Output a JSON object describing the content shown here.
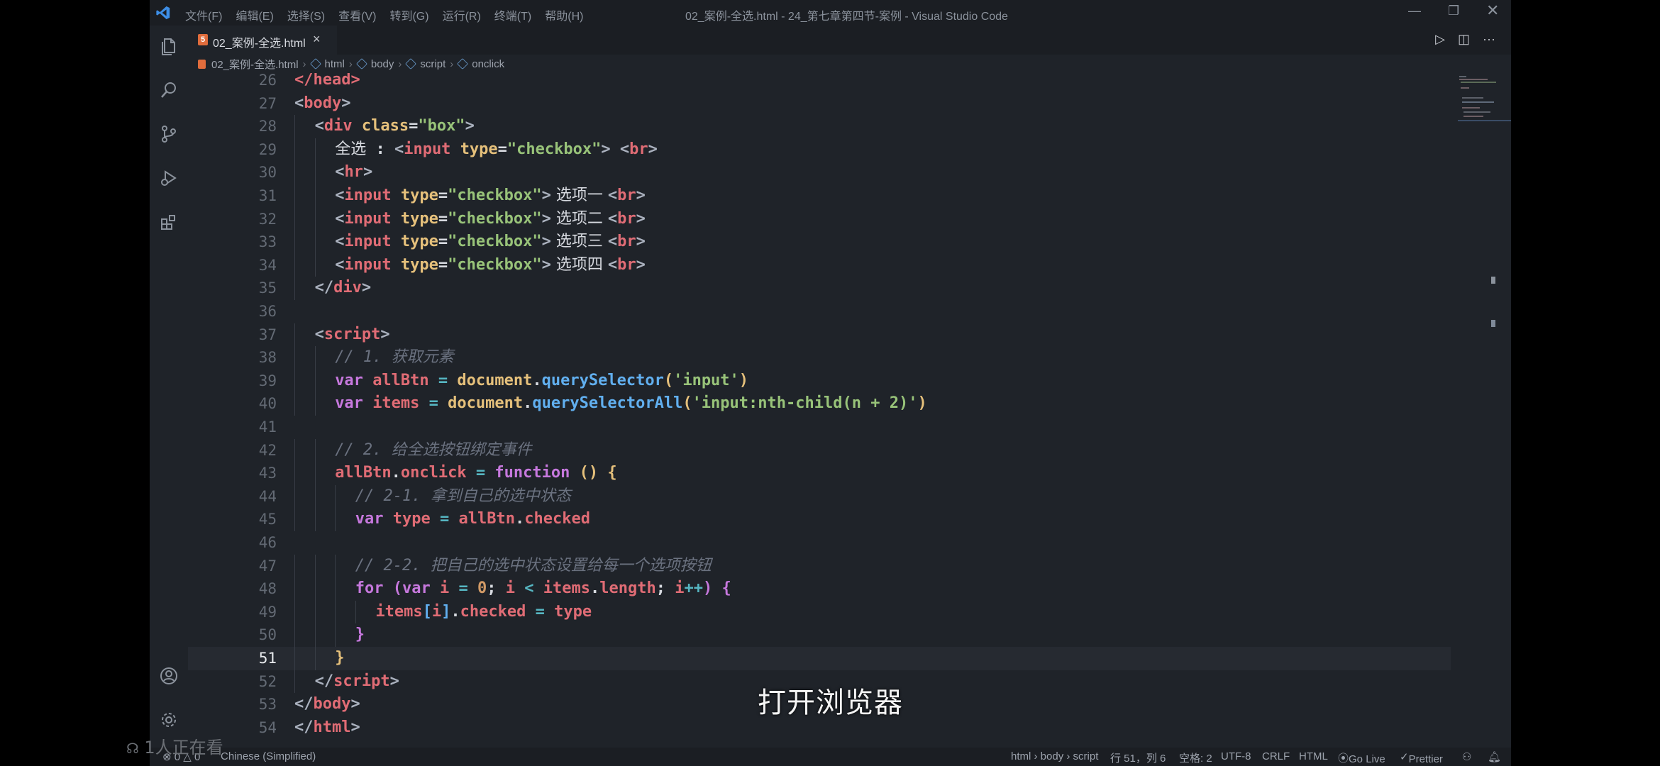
{
  "titlebar": {
    "menus": [
      "文件(F)",
      "编辑(E)",
      "选择(S)",
      "查看(V)",
      "转到(G)",
      "运行(R)",
      "终端(T)",
      "帮助(H)"
    ],
    "window_title": "02_案例-全选.html - 24_第七章第四节-案例 - Visual Studio Code"
  },
  "tab": {
    "label": "02_案例-全选.html"
  },
  "breadcrumb": [
    "02_案例-全选.html",
    "html",
    "body",
    "script",
    "onclick"
  ],
  "editor": {
    "active_line": "51",
    "lines": [
      {
        "n": "26",
        "indent": 0,
        "tokens": [
          [
            "t-tag",
            "</head>"
          ]
        ]
      },
      {
        "n": "27",
        "indent": 0,
        "tokens": [
          [
            "t-br",
            "<"
          ],
          [
            "t-tag",
            "body"
          ],
          [
            "t-br",
            ">"
          ]
        ]
      },
      {
        "n": "28",
        "indent": 1,
        "tokens": [
          [
            "t-br",
            "<"
          ],
          [
            "t-tag",
            "div"
          ],
          [
            "t-plain",
            " "
          ],
          [
            "t-attr",
            "class"
          ],
          [
            "t-plain",
            "="
          ],
          [
            "t-str",
            "\"box\""
          ],
          [
            "t-br",
            ">"
          ]
        ]
      },
      {
        "n": "29",
        "indent": 2,
        "tokens": [
          [
            "t-plain t-cjk",
            "全选"
          ],
          [
            "t-plain",
            " : "
          ],
          [
            "t-br",
            "<"
          ],
          [
            "t-tag",
            "input"
          ],
          [
            "t-plain",
            " "
          ],
          [
            "t-attr",
            "type"
          ],
          [
            "t-plain",
            "="
          ],
          [
            "t-str",
            "\"checkbox\""
          ],
          [
            "t-br",
            ">"
          ],
          [
            "t-plain",
            " "
          ],
          [
            "t-br",
            "<"
          ],
          [
            "t-tag",
            "br"
          ],
          [
            "t-br",
            ">"
          ]
        ]
      },
      {
        "n": "30",
        "indent": 2,
        "tokens": [
          [
            "t-br",
            "<"
          ],
          [
            "t-tag",
            "hr"
          ],
          [
            "t-br",
            ">"
          ]
        ]
      },
      {
        "n": "31",
        "indent": 2,
        "tokens": [
          [
            "t-br",
            "<"
          ],
          [
            "t-tag",
            "input"
          ],
          [
            "t-plain",
            " "
          ],
          [
            "t-attr",
            "type"
          ],
          [
            "t-plain",
            "="
          ],
          [
            "t-str",
            "\"checkbox\""
          ],
          [
            "t-br",
            ">"
          ],
          [
            "t-plain t-cjk",
            " 选项一 "
          ],
          [
            "t-br",
            "<"
          ],
          [
            "t-tag",
            "br"
          ],
          [
            "t-br",
            ">"
          ]
        ]
      },
      {
        "n": "32",
        "indent": 2,
        "tokens": [
          [
            "t-br",
            "<"
          ],
          [
            "t-tag",
            "input"
          ],
          [
            "t-plain",
            " "
          ],
          [
            "t-attr",
            "type"
          ],
          [
            "t-plain",
            "="
          ],
          [
            "t-str",
            "\"checkbox\""
          ],
          [
            "t-br",
            ">"
          ],
          [
            "t-plain t-cjk",
            " 选项二 "
          ],
          [
            "t-br",
            "<"
          ],
          [
            "t-tag",
            "br"
          ],
          [
            "t-br",
            ">"
          ]
        ]
      },
      {
        "n": "33",
        "indent": 2,
        "tokens": [
          [
            "t-br",
            "<"
          ],
          [
            "t-tag",
            "input"
          ],
          [
            "t-plain",
            " "
          ],
          [
            "t-attr",
            "type"
          ],
          [
            "t-plain",
            "="
          ],
          [
            "t-str",
            "\"checkbox\""
          ],
          [
            "t-br",
            ">"
          ],
          [
            "t-plain t-cjk",
            " 选项三 "
          ],
          [
            "t-br",
            "<"
          ],
          [
            "t-tag",
            "br"
          ],
          [
            "t-br",
            ">"
          ]
        ]
      },
      {
        "n": "34",
        "indent": 2,
        "tokens": [
          [
            "t-br",
            "<"
          ],
          [
            "t-tag",
            "input"
          ],
          [
            "t-plain",
            " "
          ],
          [
            "t-attr",
            "type"
          ],
          [
            "t-plain",
            "="
          ],
          [
            "t-str",
            "\"checkbox\""
          ],
          [
            "t-br",
            ">"
          ],
          [
            "t-plain t-cjk",
            " 选项四 "
          ],
          [
            "t-br",
            "<"
          ],
          [
            "t-tag",
            "br"
          ],
          [
            "t-br",
            ">"
          ]
        ]
      },
      {
        "n": "35",
        "indent": 1,
        "tokens": [
          [
            "t-br",
            "</"
          ],
          [
            "t-tag",
            "div"
          ],
          [
            "t-br",
            ">"
          ]
        ]
      },
      {
        "n": "36",
        "indent": 0,
        "tokens": []
      },
      {
        "n": "37",
        "indent": 1,
        "tokens": [
          [
            "t-br",
            "<"
          ],
          [
            "t-tag",
            "script"
          ],
          [
            "t-br",
            ">"
          ]
        ]
      },
      {
        "n": "38",
        "indent": 2,
        "tokens": [
          [
            "t-cm",
            "// 1. 获取元素"
          ]
        ]
      },
      {
        "n": "39",
        "indent": 2,
        "tokens": [
          [
            "t-kw",
            "var"
          ],
          [
            "t-plain",
            " "
          ],
          [
            "t-var",
            "allBtn"
          ],
          [
            "t-plain",
            " "
          ],
          [
            "t-op",
            "="
          ],
          [
            "t-plain",
            " "
          ],
          [
            "t-obj",
            "document"
          ],
          [
            "t-plain",
            "."
          ],
          [
            "t-fn",
            "querySelector"
          ],
          [
            "t-p1",
            "("
          ],
          [
            "t-str",
            "'input'"
          ],
          [
            "t-p1",
            ")"
          ]
        ]
      },
      {
        "n": "40",
        "indent": 2,
        "tokens": [
          [
            "t-kw",
            "var"
          ],
          [
            "t-plain",
            " "
          ],
          [
            "t-var",
            "items"
          ],
          [
            "t-plain",
            " "
          ],
          [
            "t-op",
            "="
          ],
          [
            "t-plain",
            " "
          ],
          [
            "t-obj",
            "document"
          ],
          [
            "t-plain",
            "."
          ],
          [
            "t-fn",
            "querySelectorAll"
          ],
          [
            "t-p1",
            "("
          ],
          [
            "t-str",
            "'input:nth-child(n + 2)'"
          ],
          [
            "t-p1",
            ")"
          ]
        ]
      },
      {
        "n": "41",
        "indent": 0,
        "tokens": []
      },
      {
        "n": "42",
        "indent": 2,
        "tokens": [
          [
            "t-cm",
            "// 2. 给全选按钮绑定事件"
          ]
        ]
      },
      {
        "n": "43",
        "indent": 2,
        "tokens": [
          [
            "t-var",
            "allBtn"
          ],
          [
            "t-plain",
            "."
          ],
          [
            "t-var",
            "onclick"
          ],
          [
            "t-plain",
            " "
          ],
          [
            "t-op",
            "="
          ],
          [
            "t-plain",
            " "
          ],
          [
            "t-kw",
            "function"
          ],
          [
            "t-plain",
            " "
          ],
          [
            "t-p1",
            "()"
          ],
          [
            "t-plain",
            " "
          ],
          [
            "t-p1",
            "{"
          ]
        ]
      },
      {
        "n": "44",
        "indent": 3,
        "tokens": [
          [
            "t-cm",
            "// 2-1. 拿到自己的选中状态"
          ]
        ]
      },
      {
        "n": "45",
        "indent": 3,
        "tokens": [
          [
            "t-kw",
            "var"
          ],
          [
            "t-plain",
            " "
          ],
          [
            "t-var",
            "type"
          ],
          [
            "t-plain",
            " "
          ],
          [
            "t-op",
            "="
          ],
          [
            "t-plain",
            " "
          ],
          [
            "t-var",
            "allBtn"
          ],
          [
            "t-plain",
            "."
          ],
          [
            "t-var",
            "checked"
          ]
        ]
      },
      {
        "n": "46",
        "indent": 0,
        "tokens": []
      },
      {
        "n": "47",
        "indent": 3,
        "tokens": [
          [
            "t-cm",
            "// 2-2. 把自己的选中状态设置给每一个选项按钮"
          ]
        ]
      },
      {
        "n": "48",
        "indent": 3,
        "tokens": [
          [
            "t-kw",
            "for"
          ],
          [
            "t-plain",
            " "
          ],
          [
            "t-p2",
            "("
          ],
          [
            "t-kw",
            "var"
          ],
          [
            "t-plain",
            " "
          ],
          [
            "t-var",
            "i"
          ],
          [
            "t-plain",
            " "
          ],
          [
            "t-op",
            "="
          ],
          [
            "t-plain",
            " "
          ],
          [
            "t-num",
            "0"
          ],
          [
            "t-plain",
            "; "
          ],
          [
            "t-var",
            "i"
          ],
          [
            "t-plain",
            " "
          ],
          [
            "t-op",
            "<"
          ],
          [
            "t-plain",
            " "
          ],
          [
            "t-var",
            "items"
          ],
          [
            "t-plain",
            "."
          ],
          [
            "t-var",
            "length"
          ],
          [
            "t-plain",
            "; "
          ],
          [
            "t-var",
            "i"
          ],
          [
            "t-op",
            "++"
          ],
          [
            "t-p2",
            ")"
          ],
          [
            "t-plain",
            " "
          ],
          [
            "t-p2",
            "{"
          ]
        ]
      },
      {
        "n": "49",
        "indent": 4,
        "tokens": [
          [
            "t-var",
            "items"
          ],
          [
            "t-fn",
            "["
          ],
          [
            "t-var",
            "i"
          ],
          [
            "t-fn",
            "]"
          ],
          [
            "t-plain",
            "."
          ],
          [
            "t-var",
            "checked"
          ],
          [
            "t-plain",
            " "
          ],
          [
            "t-op",
            "="
          ],
          [
            "t-plain",
            " "
          ],
          [
            "t-var",
            "type"
          ]
        ]
      },
      {
        "n": "50",
        "indent": 3,
        "tokens": [
          [
            "t-p2",
            "}"
          ]
        ]
      },
      {
        "n": "51",
        "indent": 2,
        "tokens": [
          [
            "t-p1",
            "}"
          ]
        ]
      },
      {
        "n": "52",
        "indent": 1,
        "tokens": [
          [
            "t-br",
            "</"
          ],
          [
            "t-tag",
            "script"
          ],
          [
            "t-br",
            ">"
          ]
        ]
      },
      {
        "n": "53",
        "indent": 0,
        "tokens": [
          [
            "t-br",
            "</"
          ],
          [
            "t-tag",
            "body"
          ],
          [
            "t-br",
            ">"
          ]
        ]
      },
      {
        "n": "54",
        "indent": 0,
        "tokens": [
          [
            "t-br",
            "</"
          ],
          [
            "t-tag",
            "html"
          ],
          [
            "t-br",
            ">"
          ]
        ]
      }
    ]
  },
  "statusbar": {
    "problems": "⊗ 0 △ 0",
    "language_pack": "Chinese (Simplified)",
    "path": "html › body › script",
    "position": "行 51，列 6",
    "spaces": "空格: 2",
    "encoding": "UTF-8",
    "eol": "CRLF",
    "language": "HTML",
    "go_live": "Go Live",
    "prettier": "Prettier"
  },
  "overlay": {
    "subtitle": "打开浏览器",
    "viewers": "1人正在看"
  },
  "colors": {
    "editor_bg": "#1f2329",
    "tag": "#e06c75",
    "string": "#98c379",
    "attribute": "#e5c07b",
    "keyword": "#c678dd",
    "function": "#61afef",
    "comment": "#6b7280",
    "accent_blue": "#3d8ee6"
  }
}
